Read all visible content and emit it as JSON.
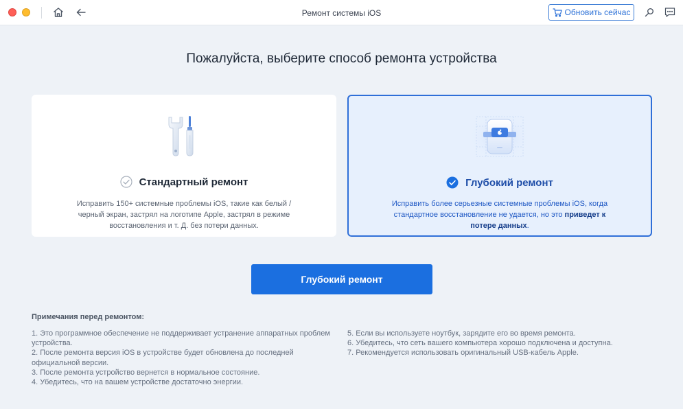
{
  "window": {
    "title": "Ремонт системы iOS",
    "update_button": "Обновить сейчас"
  },
  "headline": "Пожалуйста, выберите способ ремонта устройства",
  "modes": {
    "standard": {
      "title": "Стандартный ремонт",
      "description": "Исправить 150+ системные проблемы iOS, такие как белый / черный экран, застрял на логотипе Apple, застрял в режиме восстановления и т. Д. без потери данных.",
      "selected": false
    },
    "deep": {
      "title": "Глубокий ремонт",
      "description_prefix": "Исправить более серьезные системные проблемы iOS, когда стандартное восстановление не удается, но это ",
      "description_bold": "приведет к потере данных",
      "description_suffix": ".",
      "selected": true
    }
  },
  "primary_button": "Глубокий ремонт",
  "notes": {
    "title": "Примечания перед ремонтом:",
    "left": [
      "1. Это программное обеспечение не поддерживает устранение аппаратных проблем устройства.",
      "2. После ремонта версия iOS в устройстве будет обновлена до последней официальной версии.",
      "3. После ремонта устройство вернется в нормальное состояние.",
      "4. Убедитесь, что на вашем устройстве достаточно энергии."
    ],
    "right": [
      "5. Если вы используете ноутбук, зарядите его во время ремонта.",
      "6. Убедитесь, что сеть вашего компьютера хорошо подключена и доступна.",
      "7. Рекомендуется использовать оригинальный USB-кабель Apple."
    ]
  },
  "colors": {
    "accent": "#1b6fe0",
    "selected_card_bg": "#e7f0fd",
    "selected_card_border": "#2f6fd8"
  },
  "icons": {
    "home": "home-icon",
    "back": "back-arrow-icon",
    "cart": "cart-icon",
    "search": "search-icon",
    "feedback": "feedback-icon",
    "standard_illustration": "tools-icon",
    "deep_illustration": "device-chip-icon",
    "check": "check-circle-icon"
  }
}
